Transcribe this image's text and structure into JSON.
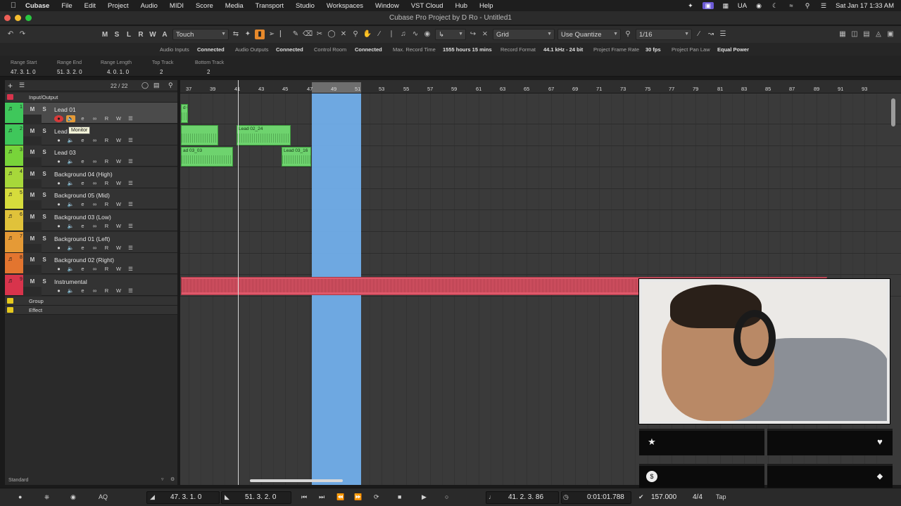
{
  "menubar": {
    "app": "Cubase",
    "items": [
      "File",
      "Edit",
      "Project",
      "Audio",
      "MIDI",
      "Score",
      "Media",
      "Transport",
      "Studio",
      "Workspaces",
      "Window",
      "VST Cloud",
      "Hub",
      "Help"
    ],
    "input_source": "UA",
    "datetime": "Sat Jan 17  1:33 AM"
  },
  "window": {
    "title": "Cubase Pro Project by D Ro - Untitled1"
  },
  "toolbar": {
    "mode_buttons": [
      "M",
      "S",
      "L",
      "R",
      "W",
      "A"
    ],
    "automation_mode": "Touch",
    "snap_type": "Grid",
    "quantize_mode": "Use Quantize",
    "quantize_value": "1/16"
  },
  "status": {
    "audio_inputs_label": "Audio Inputs",
    "audio_inputs_value": "Connected",
    "audio_outputs_label": "Audio Outputs",
    "audio_outputs_value": "Connected",
    "control_room_label": "Control Room",
    "control_room_value": "Connected",
    "max_rec_label": "Max. Record Time",
    "max_rec_value": "1555 hours 15 mins",
    "rec_format_label": "Record Format",
    "rec_format_value": "44.1 kHz - 24 bit",
    "frame_rate_label": "Project Frame Rate",
    "frame_rate_value": "30 fps",
    "pan_law_label": "Project Pan Law",
    "pan_law_value": "Equal Power"
  },
  "infoline": {
    "range_start_label": "Range Start",
    "range_start_value": "47. 3. 1.   0",
    "range_end_label": "Range End",
    "range_end_value": "51. 3. 2.   0",
    "range_length_label": "Range Length",
    "range_length_value": "4. 0. 1.   0",
    "top_track_label": "Top Track",
    "top_track_value": "2",
    "bottom_track_label": "Bottom Track",
    "bottom_track_value": "2"
  },
  "tracklist": {
    "count": "22 / 22",
    "input_output": "Input/Output",
    "tracks": [
      {
        "num": "1",
        "name": "Lead 01",
        "color": "#3fc75b"
      },
      {
        "num": "2",
        "name": "Lead 02",
        "color": "#3fc75b"
      },
      {
        "num": "3",
        "name": "Lead 03",
        "color": "#78d43a"
      },
      {
        "num": "4",
        "name": "Background 04 (High)",
        "color": "#a7d83a"
      },
      {
        "num": "5",
        "name": "Background 05 (Mid)",
        "color": "#d6dc3c"
      },
      {
        "num": "6",
        "name": "Background 03 (Low)",
        "color": "#e0c23a"
      },
      {
        "num": "7",
        "name": "Background 01 (Left)",
        "color": "#e59a36"
      },
      {
        "num": "8",
        "name": "Background 02 (Right)",
        "color": "#e3752f"
      },
      {
        "num": "9",
        "name": "Instrumental",
        "color": "#d8344c"
      }
    ],
    "folders": [
      {
        "name": "Group",
        "color": "#e5c81e"
      },
      {
        "name": "Effect",
        "color": "#e5c81e"
      }
    ],
    "tooltip": "Monitor",
    "footer": "Standard"
  },
  "ruler": {
    "ticks": [
      "37",
      "39",
      "41",
      "43",
      "45",
      "47",
      "49",
      "51",
      "53",
      "55",
      "57",
      "59",
      "61",
      "63",
      "65",
      "67",
      "69",
      "71",
      "73",
      "75",
      "77",
      "79",
      "81",
      "83",
      "85",
      "87",
      "89",
      "91",
      "93"
    ]
  },
  "events": {
    "lead01_label": "d 0",
    "lead02_label": "Lead 02_24",
    "lead03a_label": "ad 03_03",
    "lead03b_label": "Lead 03_16"
  },
  "transport": {
    "left_locator": "47. 3. 1.   0",
    "right_locator": "51. 3. 2.   0",
    "position_bars": "41. 2. 3.  86",
    "position_time": "0:01:01.788",
    "tempo": "157.000",
    "signature": "4/4",
    "tap": "Tap",
    "aq": "AQ"
  },
  "colors": {
    "loop_region": "#78bcff",
    "audio_event": "#6ed36e",
    "instrumental_event": "#e0586a",
    "record_active": "#d93a3a"
  }
}
